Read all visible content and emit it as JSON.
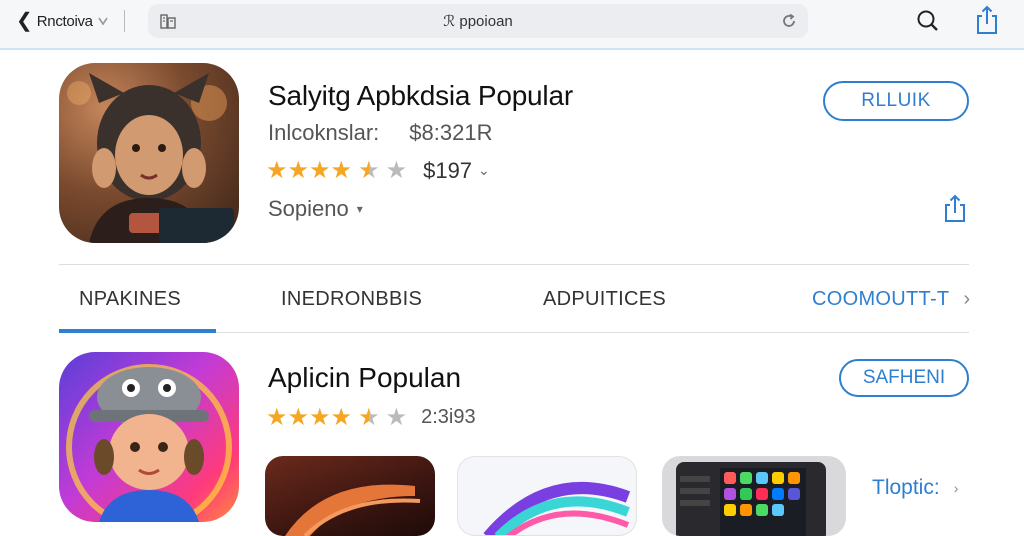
{
  "topbar": {
    "back_label": "Rnctoiva",
    "back_chevron": "❮",
    "url_text": "ℛ ppoioan",
    "icons": [
      "chevron-left-icon",
      "building-icon",
      "reload-icon",
      "search-icon",
      "share-icon"
    ]
  },
  "app1": {
    "title": "Salyitg Apbkdsia Popular",
    "category": "Inlcoknslar:",
    "price_info": "$8:321R",
    "rating": 4.5,
    "stars": "★★★★",
    "star_half": "★",
    "star_empty": "★",
    "price": "$197",
    "price_chevron": "⌄",
    "developer": "Sopieno",
    "developer_caret": "▾",
    "action_button": "RLLUIK"
  },
  "tabs": {
    "items": [
      "NPAKINES",
      "INEDRONBBIS",
      "ADPUITICES",
      "COOMOUTT-T"
    ],
    "active_index": 0,
    "more_chevron": "›"
  },
  "app2": {
    "title": "Aplicin Populan",
    "rating": 4.5,
    "stars": "★★★★",
    "star_half": "★",
    "star_empty": "★",
    "rating_count": "2:3i93",
    "action_button": "SAFHENI",
    "more_label": "Tloptic:",
    "more_chevron": "›"
  },
  "colors": {
    "accent": "#2f7fd1",
    "star": "#f5a623",
    "text": "#111111",
    "muted": "#555555"
  }
}
